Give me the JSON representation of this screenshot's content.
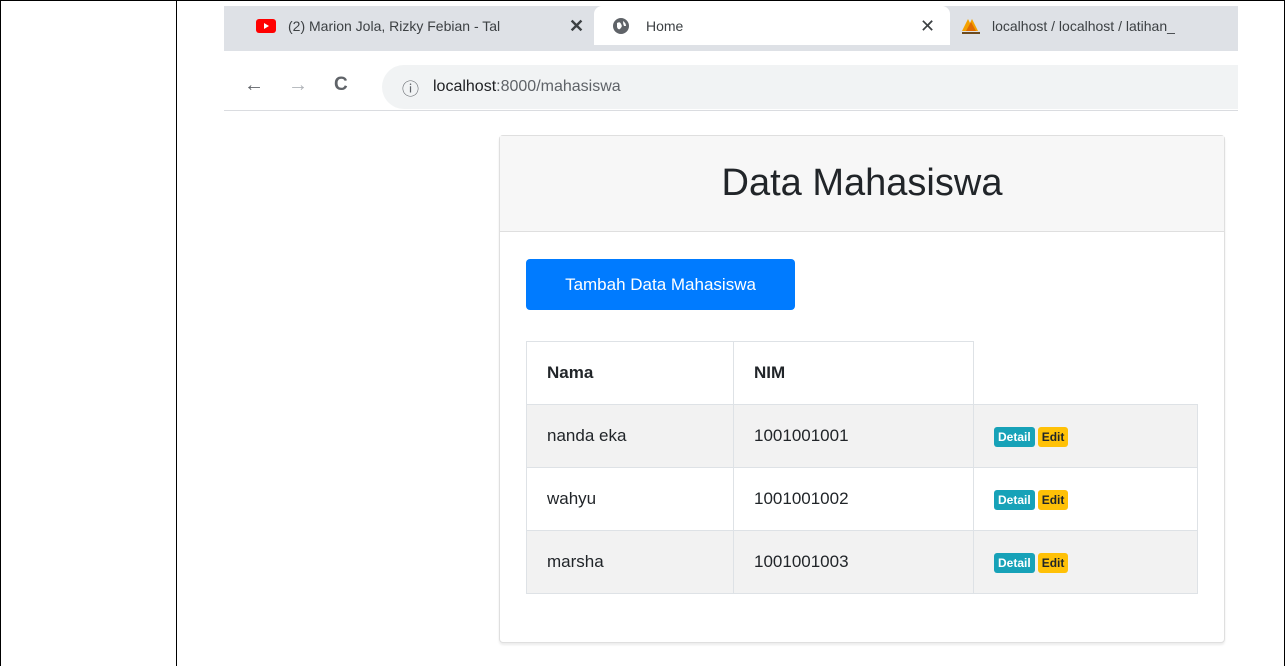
{
  "browser": {
    "tabs": [
      {
        "title": "(2) Marion Jola, Rizky Febian - Tal",
        "icon": "youtube-icon"
      },
      {
        "title": "Home",
        "icon": "globe-icon",
        "active": true
      },
      {
        "title": "localhost / localhost / latihan_",
        "icon": "phpmyadmin-icon"
      }
    ],
    "close_glyph": "✕",
    "url": {
      "host": "localhost",
      "path": ":8000/mahasiswa"
    },
    "nav": {
      "back": "←",
      "forward": "→",
      "reload": "C",
      "info": "ⓘ"
    }
  },
  "page": {
    "title": "Data Mahasiswa",
    "add_button": "Tambah Data Mahasiswa",
    "table": {
      "headers": [
        "Nama",
        "NIM"
      ],
      "rows": [
        {
          "nama": "nanda eka",
          "nim": "1001001001"
        },
        {
          "nama": "wahyu",
          "nim": "1001001002"
        },
        {
          "nama": "marsha",
          "nim": "1001001003"
        }
      ],
      "actions": {
        "detail": "Detail",
        "edit": "Edit"
      }
    }
  },
  "colors": {
    "primary": "#007bff",
    "info": "#17a2b8",
    "warning": "#ffc107",
    "youtube": "#ff0000"
  }
}
